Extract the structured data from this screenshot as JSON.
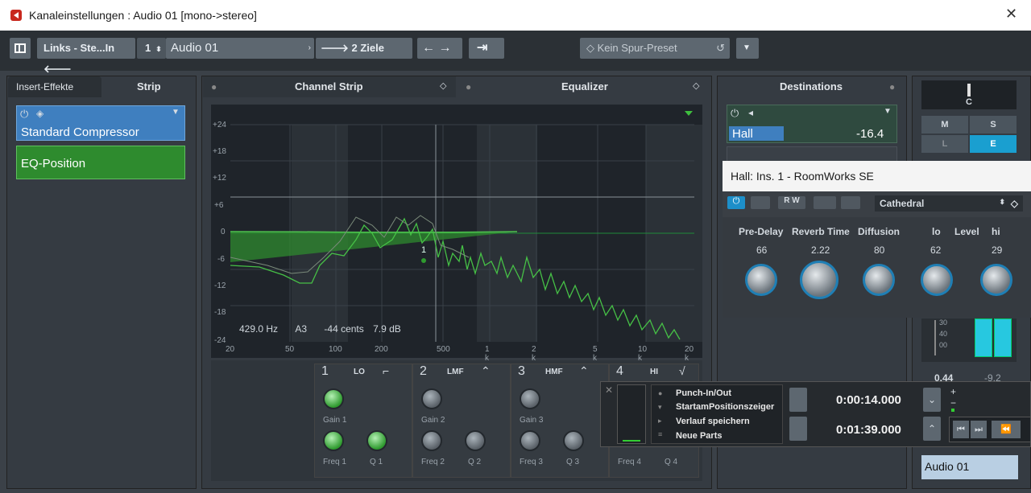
{
  "window": {
    "title": "Kanaleinstellungen : Audio 01 [mono->stereo]",
    "close": "✕"
  },
  "toolbar": {
    "routing": "Links - Ste...In",
    "track_number": "1",
    "track_name": "Audio 01",
    "destinations": "2 Ziele",
    "preset": "Kein Spur-Preset"
  },
  "inserts": {
    "tab_insert": "Insert-Effekte",
    "tab_strip": "Strip",
    "slot1": "Standard Compressor",
    "slot2": "EQ-Position"
  },
  "center": {
    "tab_channel_strip": "Channel Strip",
    "tab_equalizer": "Equalizer"
  },
  "eq": {
    "db_ticks": [
      "+24",
      "+18",
      "+12",
      "+6",
      "0",
      "-6",
      "-12",
      "-18",
      "-24"
    ],
    "hz_ticks": [
      "20",
      "50",
      "100",
      "200",
      "500",
      "1 k",
      "2 k",
      "5 k",
      "10 k",
      "20 k"
    ],
    "readout_hz": "429.0 Hz",
    "readout_note": "A3",
    "readout_cents": "-44 cents",
    "readout_db": "7.9 dB",
    "marker": "1",
    "bands": [
      {
        "num": "1",
        "name": "LO",
        "gain": "Gain 1",
        "freq": "Freq 1",
        "q": "Q 1"
      },
      {
        "num": "2",
        "name": "LMF",
        "gain": "Gain 2",
        "freq": "Freq 2",
        "q": "Q 2"
      },
      {
        "num": "3",
        "name": "HMF",
        "gain": "Gain 3",
        "freq": "Freq 3",
        "q": "Q 3"
      },
      {
        "num": "4",
        "name": "HI",
        "freq": "Freq 4",
        "q": "Q 4"
      }
    ]
  },
  "destinations": {
    "title": "Destinations",
    "send_name": "Hall",
    "send_value": "-16.4"
  },
  "rightstrip": {
    "pan": "C",
    "btn_m": "M",
    "btn_s": "S",
    "btn_l": "L",
    "btn_e": "E",
    "meter_ticks": [
      "30",
      "40",
      "00"
    ],
    "val1": "0.44",
    "val2": "-9.2",
    "channel_name": "Audio 01"
  },
  "roomworks": {
    "title": "Hall: Ins. 1 - RoomWorks SE",
    "preset": "Cathedral",
    "params": [
      {
        "label": "Pre-Delay",
        "value": "66"
      },
      {
        "label": "Reverb Time",
        "value": "2.22"
      },
      {
        "label": "Diffusion",
        "value": "80"
      },
      {
        "label": "lo",
        "value": "62"
      },
      {
        "label": "hi",
        "value": "29"
      }
    ],
    "level_label": "Level"
  },
  "transport": {
    "items": [
      "Punch-In/Out",
      "StartamPositionszeiger",
      "Verlauf speichern",
      "Neue Parts"
    ],
    "time1": "0:00:14.000",
    "time2": "0:01:39.000"
  }
}
